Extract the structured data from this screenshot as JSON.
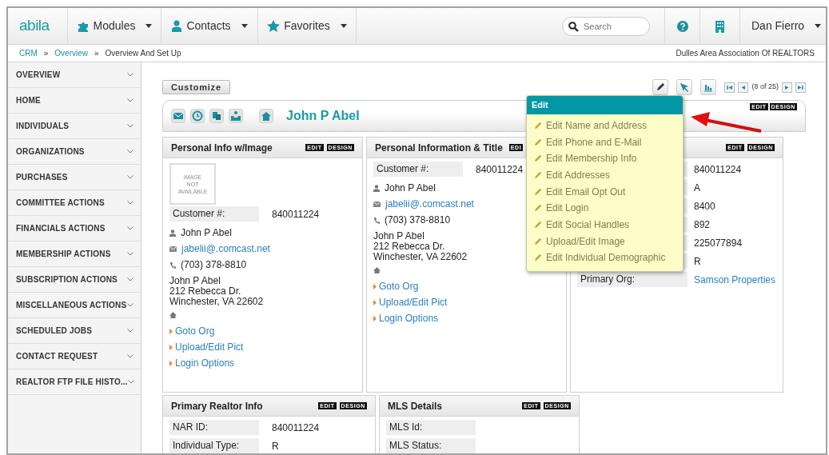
{
  "header": {
    "logo": "abila",
    "menus": [
      {
        "label": "Modules"
      },
      {
        "label": "Contacts"
      },
      {
        "label": "Favorites"
      }
    ],
    "search": {
      "placeholder": "Search"
    },
    "user": "Dan Fierro"
  },
  "breadcrumb": {
    "items": [
      {
        "label": "CRM",
        "link": true
      },
      {
        "label": "Overview",
        "link": true
      },
      {
        "label": "Overview And Set Up",
        "link": false
      }
    ],
    "separator": "»",
    "organization": "Dulles Area Association Of REALTORS"
  },
  "sidebar": {
    "items": [
      {
        "label": "OVERVIEW"
      },
      {
        "label": "HOME"
      },
      {
        "label": "INDIVIDUALS"
      },
      {
        "label": "ORGANIZATIONS"
      },
      {
        "label": "PURCHASES"
      },
      {
        "label": "COMMITTEE ACTIONS"
      },
      {
        "label": "FINANCIALS ACTIONS"
      },
      {
        "label": "MEMBERSHIP ACTIONS"
      },
      {
        "label": "SUBSCRIPTION ACTIONS"
      },
      {
        "label": "MISCELLANEOUS ACTIONS"
      },
      {
        "label": "SCHEDULED JOBS"
      },
      {
        "label": "CONTACT REQUEST"
      },
      {
        "label": "REALTOR FTP FILE HISTO..."
      }
    ]
  },
  "toolbar": {
    "customize": "Customize",
    "pager": "(8 of 25)"
  },
  "record": {
    "name": "John P Abel",
    "badges": [
      "EDIT",
      "DESIGN"
    ]
  },
  "cards": [
    {
      "title": "Personal Info w/Image",
      "badges": [
        "EDIT",
        "DESIGN"
      ],
      "image_text": [
        "IMAGE",
        "NOT",
        "AVAILABLE"
      ],
      "fields": [
        {
          "label": "Customer #:",
          "value": "840011224"
        }
      ],
      "contact": {
        "name": "John P Abel",
        "email": "jabelii@.comcast.net",
        "phone": "(703) 378-8810",
        "address": [
          "John P Abel",
          "212 Rebecca Dr.",
          "Winchester, VA 22602"
        ]
      },
      "links": [
        "Goto Org",
        "Upload/Edit Pict",
        "Login Options"
      ]
    },
    {
      "title": "Personal Information & Title",
      "badges": [
        "EDI"
      ],
      "fields": [
        {
          "label": "Customer #:",
          "value": "840011224"
        }
      ],
      "contact": {
        "name": "John P Abel",
        "email": "jabelii@.comcast.net",
        "phone": "(703) 378-8810",
        "address": [
          "John P Abel",
          "212 Rebecca Dr.",
          "Winchester, VA 22602"
        ]
      },
      "links": [
        "Goto Org",
        "Upload/Edit Pict",
        "Login Options"
      ]
    },
    {
      "badges": [
        "EDIT",
        "DESIGN"
      ],
      "fields": [
        {
          "value": "840011224"
        },
        {
          "value": "A"
        },
        {
          "value": "8400"
        },
        {
          "value": "892"
        },
        {
          "value": "225077894"
        },
        {
          "value": "R"
        },
        {
          "label": "Primary Org:",
          "value": "Samson Properties",
          "link": true
        }
      ]
    }
  ],
  "cards_row2": [
    {
      "title": "Primary Realtor Info",
      "badges": [
        "EDIT",
        "DESIGN"
      ],
      "fields": [
        {
          "label": "NAR ID:",
          "value": "840011224"
        },
        {
          "label": "Individual Type:",
          "value": "R"
        }
      ]
    },
    {
      "title": "MLS Details",
      "badges": [
        "EDIT",
        "DESIGN"
      ],
      "fields": [
        {
          "label": "MLS Id:"
        },
        {
          "label": "MLS Status:"
        }
      ]
    }
  ],
  "edit_menu": {
    "title": "Edit",
    "items": [
      "Edit Name and Address",
      "Edit Phone and E-Mail",
      "Edit Membership Info",
      "Edit Addresses",
      "Edit Email Opt Out",
      "Edit Login",
      "Edit Social Handles",
      "Upload/Edit Image",
      "Edit Individual Demographic"
    ]
  }
}
